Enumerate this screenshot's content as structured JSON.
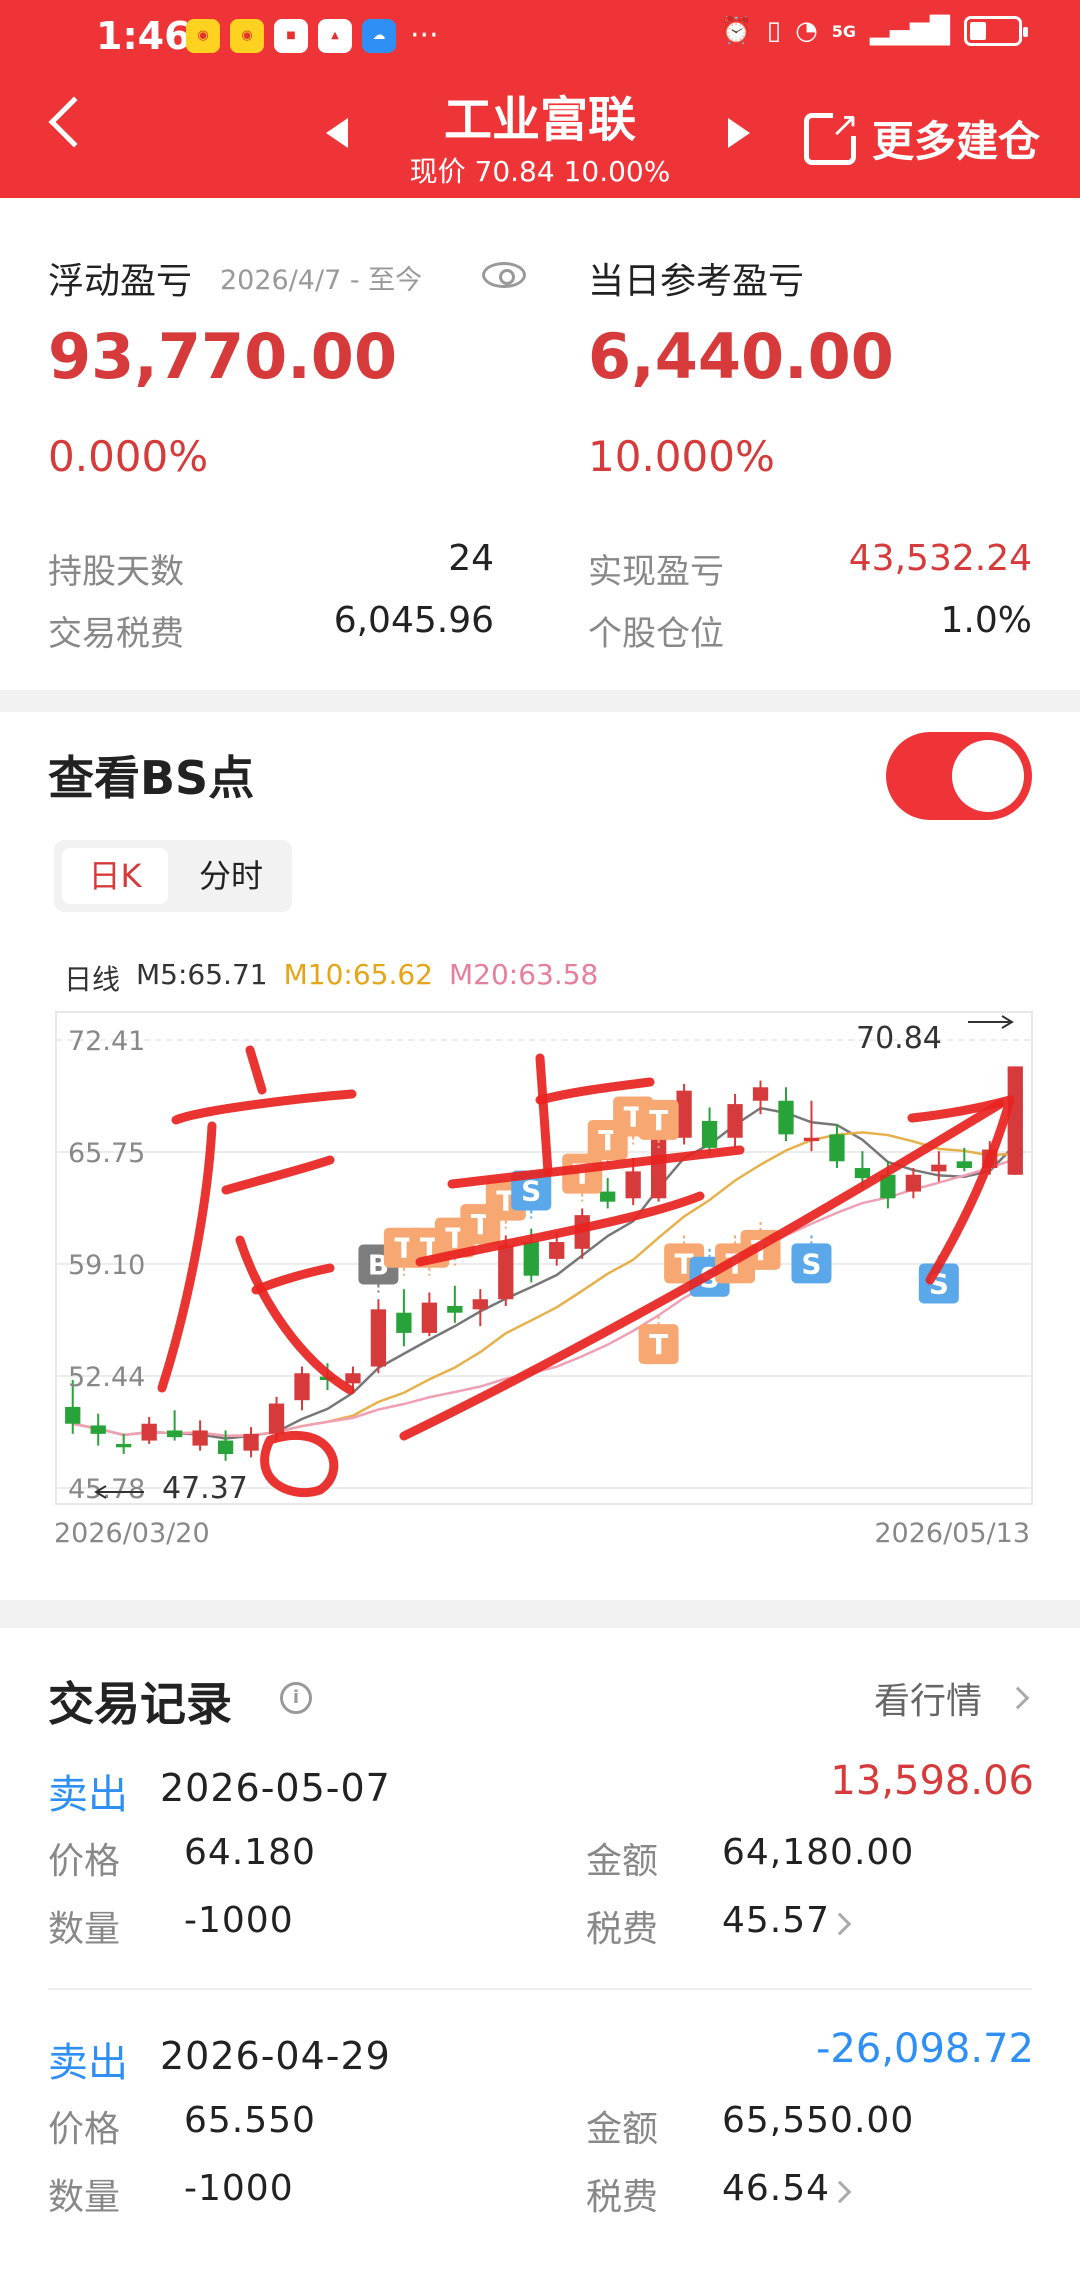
{
  "status_bar": {
    "time": "1:46",
    "app_icons": [
      "weibo-icon",
      "weibo-icon",
      "xiaohongshu-icon",
      "app-icon",
      "cloud-icon"
    ],
    "network": "5G",
    "battery_level": 0.35
  },
  "header": {
    "title": "工业富联",
    "subtitle": "现价 70.84 10.00%",
    "more_label": "更多建仓"
  },
  "summary": {
    "float_label": "浮动盈亏",
    "float_date": "2026/4/7 - 至今",
    "float_value": "93,770.00",
    "float_pct": "0.000%",
    "day_label": "当日参考盈亏",
    "day_value": "6,440.00",
    "day_pct": "10.000%",
    "hold_days_label": "持股天数",
    "hold_days_value": "24",
    "fee_label": "交易税费",
    "fee_value": "6,045.96",
    "realized_label": "实现盈亏",
    "realized_value": "43,532.24",
    "position_label": "个股仓位",
    "position_value": "1.0%"
  },
  "bs": {
    "title": "查看BS点",
    "toggle_on": true,
    "tabs": [
      "日K",
      "分时"
    ],
    "active_tab": "日K",
    "ma": {
      "label": "日线",
      "m5": "M5:65.71",
      "m10": "M10:65.62",
      "m20": "M20:63.58"
    }
  },
  "chart_data": {
    "type": "candlestick",
    "y_ticks": [
      "72.41",
      "65.75",
      "59.10",
      "52.44",
      "45.78"
    ],
    "ylim": [
      45.78,
      72.41
    ],
    "x_labels": [
      "2026/03/20",
      "2026/05/13"
    ],
    "high_label": "70.84",
    "low_label": "47.37",
    "colors": {
      "up": "#d63a3a",
      "down": "#27a33a",
      "buy_marker": "#7d7d7d",
      "sell_marker": "#5aa7ea",
      "t_marker": "#f7a872"
    },
    "candles": [
      {
        "o": 50.6,
        "h": 52.2,
        "l": 49.0,
        "c": 49.6
      },
      {
        "o": 49.5,
        "h": 50.2,
        "l": 48.3,
        "c": 49.0
      },
      {
        "o": 48.4,
        "h": 49.0,
        "l": 47.8,
        "c": 48.2
      },
      {
        "o": 48.6,
        "h": 50.0,
        "l": 48.4,
        "c": 49.6
      },
      {
        "o": 49.2,
        "h": 50.4,
        "l": 48.6,
        "c": 48.8
      },
      {
        "o": 48.3,
        "h": 49.8,
        "l": 48.0,
        "c": 49.2
      },
      {
        "o": 48.6,
        "h": 49.2,
        "l": 47.4,
        "c": 47.8
      },
      {
        "o": 48.0,
        "h": 49.4,
        "l": 47.6,
        "c": 49.0
      },
      {
        "o": 49.0,
        "h": 51.2,
        "l": 48.6,
        "c": 50.8
      },
      {
        "o": 51.0,
        "h": 53.0,
        "l": 50.4,
        "c": 52.6
      },
      {
        "o": 52.4,
        "h": 53.2,
        "l": 51.6,
        "c": 52.2
      },
      {
        "o": 52.0,
        "h": 53.0,
        "l": 51.4,
        "c": 52.6
      },
      {
        "o": 53.0,
        "h": 57.0,
        "l": 52.6,
        "c": 56.4
      },
      {
        "o": 56.2,
        "h": 57.6,
        "l": 54.2,
        "c": 55.0
      },
      {
        "o": 55.0,
        "h": 57.4,
        "l": 54.8,
        "c": 56.8
      },
      {
        "o": 56.6,
        "h": 57.8,
        "l": 55.6,
        "c": 56.2
      },
      {
        "o": 56.4,
        "h": 57.6,
        "l": 55.4,
        "c": 57.0
      },
      {
        "o": 57.0,
        "h": 60.8,
        "l": 56.6,
        "c": 60.2
      },
      {
        "o": 60.4,
        "h": 61.2,
        "l": 58.0,
        "c": 58.4
      },
      {
        "o": 59.4,
        "h": 61.0,
        "l": 59.0,
        "c": 60.4
      },
      {
        "o": 60.0,
        "h": 62.4,
        "l": 59.4,
        "c": 62.0
      },
      {
        "o": 63.4,
        "h": 64.2,
        "l": 62.4,
        "c": 62.8
      },
      {
        "o": 63.0,
        "h": 65.4,
        "l": 62.6,
        "c": 64.6
      },
      {
        "o": 63.0,
        "h": 68.8,
        "l": 62.8,
        "c": 68.2
      },
      {
        "o": 66.6,
        "h": 69.8,
        "l": 66.2,
        "c": 69.4
      },
      {
        "o": 67.6,
        "h": 68.4,
        "l": 65.6,
        "c": 66.0
      },
      {
        "o": 66.6,
        "h": 69.2,
        "l": 66.0,
        "c": 68.6
      },
      {
        "o": 68.8,
        "h": 70.0,
        "l": 68.0,
        "c": 69.6
      },
      {
        "o": 68.8,
        "h": 69.6,
        "l": 66.4,
        "c": 66.8
      },
      {
        "o": 66.4,
        "h": 68.8,
        "l": 65.8,
        "c": 66.6
      },
      {
        "o": 66.8,
        "h": 67.4,
        "l": 64.8,
        "c": 65.2
      },
      {
        "o": 64.8,
        "h": 65.8,
        "l": 63.6,
        "c": 64.2
      },
      {
        "o": 64.4,
        "h": 65.2,
        "l": 62.4,
        "c": 63.0
      },
      {
        "o": 63.4,
        "h": 64.8,
        "l": 63.0,
        "c": 64.4
      },
      {
        "o": 64.6,
        "h": 65.8,
        "l": 64.0,
        "c": 65.0
      },
      {
        "o": 65.2,
        "h": 66.0,
        "l": 64.6,
        "c": 64.8
      },
      {
        "o": 64.8,
        "h": 66.4,
        "l": 64.4,
        "c": 65.9
      },
      {
        "o": 64.4,
        "h": 70.84,
        "l": 64.4,
        "c": 70.84
      }
    ],
    "markers": [
      {
        "i": 12,
        "text": "B",
        "kind": "buy",
        "price": 57.4,
        "pos": "above"
      },
      {
        "i": 13,
        "text": "T",
        "kind": "t",
        "price": 58.4,
        "pos": "above"
      },
      {
        "i": 14,
        "text": "T",
        "kind": "t",
        "price": 58.4,
        "pos": "above"
      },
      {
        "i": 15,
        "text": "T",
        "kind": "t",
        "price": 59.0,
        "pos": "above"
      },
      {
        "i": 16,
        "text": "T",
        "kind": "t",
        "price": 59.8,
        "pos": "above"
      },
      {
        "i": 17,
        "text": "T",
        "kind": "t",
        "price": 61.2,
        "pos": "above"
      },
      {
        "i": 18,
        "text": "S",
        "kind": "sell",
        "price": 61.8,
        "pos": "above"
      },
      {
        "i": 20,
        "text": "T",
        "kind": "t",
        "price": 62.8,
        "pos": "above"
      },
      {
        "i": 21,
        "text": "T",
        "kind": "t",
        "price": 64.8,
        "pos": "above"
      },
      {
        "i": 22,
        "text": "T",
        "kind": "t",
        "price": 66.2,
        "pos": "above"
      },
      {
        "i": 23,
        "text": "T",
        "kind": "t",
        "price": 66.0,
        "pos": "above"
      },
      {
        "i": 23,
        "text": "T",
        "kind": "t",
        "price": 56.0,
        "pos": "below"
      },
      {
        "i": 24,
        "text": "T",
        "kind": "t",
        "price": 60.8,
        "pos": "below"
      },
      {
        "i": 25,
        "text": "S",
        "kind": "sell",
        "price": 60.0,
        "pos": "below"
      },
      {
        "i": 26,
        "text": "T",
        "kind": "t",
        "price": 60.8,
        "pos": "below"
      },
      {
        "i": 27,
        "text": "T",
        "kind": "t",
        "price": 61.6,
        "pos": "below"
      },
      {
        "i": 29,
        "text": "S",
        "kind": "sell",
        "price": 60.8,
        "pos": "below"
      },
      {
        "i": 34,
        "text": "S",
        "kind": "sell",
        "price": 59.6,
        "pos": "below"
      }
    ]
  },
  "records": {
    "title": "交易记录",
    "info_icon": "info-icon",
    "market_link": "看行情",
    "items": [
      {
        "type": "卖出",
        "date": "2026-05-07",
        "pl": "13,598.06",
        "pl_color": "#d63a3a",
        "price_label": "价格",
        "price": "64.180",
        "amount_label": "金额",
        "amount": "64,180.00",
        "qty_label": "数量",
        "qty": "-1000",
        "fee_label": "税费",
        "fee": "45.57"
      },
      {
        "type": "卖出",
        "date": "2026-04-29",
        "pl": "-26,098.72",
        "pl_color": "#2e8ff5",
        "price_label": "价格",
        "price": "65.550",
        "amount_label": "金额",
        "amount": "65,550.00",
        "qty_label": "数量",
        "qty": "-1000",
        "fee_label": "税费",
        "fee": "46.54"
      }
    ]
  },
  "annotation": {
    "stroke_color": "#e8231f",
    "char_low": "底",
    "char_up": "上"
  }
}
